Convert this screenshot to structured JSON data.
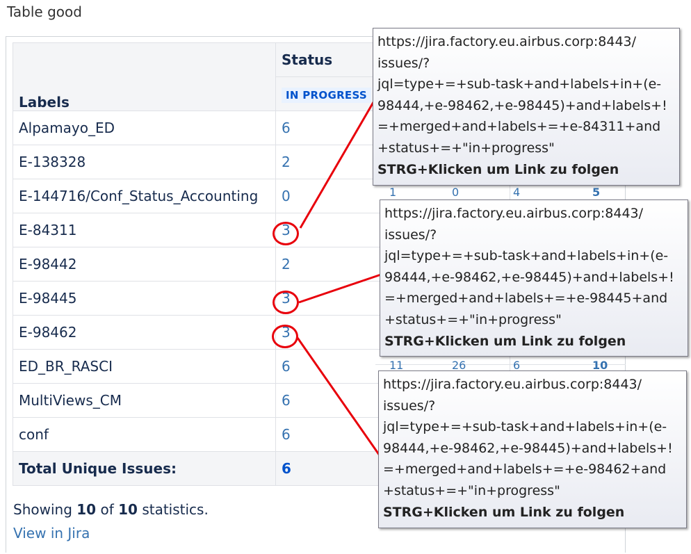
{
  "caption": "Table good",
  "table": {
    "header_labels": "Labels",
    "header_status": "Status",
    "status_lozenge": "IN PROGRESS",
    "rows": [
      {
        "label": "Alpamayo_ED",
        "value": "6"
      },
      {
        "label": "E-138328",
        "value": "2"
      },
      {
        "label": "E-144716/Conf_Status_Accounting",
        "value": "0"
      },
      {
        "label": "E-84311",
        "value": "3"
      },
      {
        "label": "E-98442",
        "value": "2"
      },
      {
        "label": "E-98445",
        "value": "3"
      },
      {
        "label": "E-98462",
        "value": "3"
      },
      {
        "label": "ED_BR_RASCI",
        "value": "6"
      },
      {
        "label": "MultiViews_CM",
        "value": "6"
      },
      {
        "label": "conf",
        "value": "6"
      }
    ],
    "total_label": "Total Unique Issues:",
    "total_value": "6"
  },
  "footer": {
    "showing_prefix": "Showing",
    "showing_count": "10",
    "showing_of": "of",
    "showing_total": "10",
    "showing_suffix": "statistics.",
    "view_link": "View in Jira"
  },
  "peek": [
    "1",
    "0",
    "4",
    "5",
    "11",
    "26",
    "6",
    "10"
  ],
  "tooltips": [
    {
      "lines": [
        "https://jira.factory.eu.airbus.corp:8443/",
        "issues/?",
        "jql=type+=+sub-task+and+labels+in+(e-",
        "98444,+e-98462,+e-98445)+and+labels+!",
        "=+merged+and+labels+=+e-84311+and",
        "+status+=+\"in+progress\""
      ],
      "hint": "STRG+Klicken um Link zu folgen"
    },
    {
      "lines": [
        "https://jira.factory.eu.airbus.corp:8443/",
        "issues/?",
        "jql=type+=+sub-task+and+labels+in+(e-",
        "98444,+e-98462,+e-98445)+and+labels+!",
        "=+merged+and+labels+=+e-98445+and",
        "+status+=+\"in+progress\""
      ],
      "hint": "STRG+Klicken um Link zu folgen"
    },
    {
      "lines": [
        "https://jira.factory.eu.airbus.corp:8443/",
        "issues/?",
        "jql=type+=+sub-task+and+labels+in+(e-",
        "98444,+e-98462,+e-98445)+and+labels+!",
        "=+merged+and+labels+=+e-98462+and",
        "+status+=+\"in+progress\""
      ],
      "hint": "STRG+Klicken um Link zu folgen"
    }
  ],
  "colors": {
    "annotation": "#e8000b",
    "link": "#3572b0",
    "lozenge_text": "#0052cc"
  }
}
